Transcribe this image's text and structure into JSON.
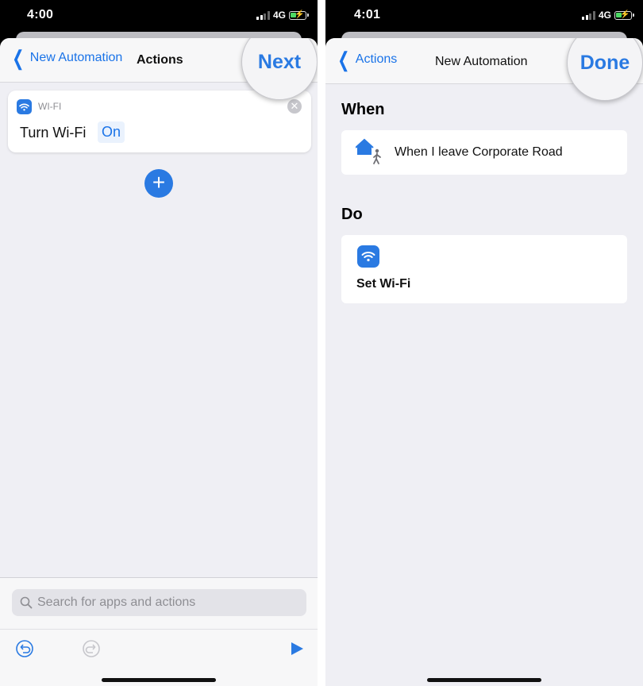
{
  "left": {
    "status": {
      "time": "4:00",
      "network": "4G"
    },
    "nav": {
      "back_label": "New Automation",
      "title": "Actions",
      "next_label": "Next"
    },
    "action_card": {
      "category": "WI-FI",
      "action": "Turn Wi-Fi",
      "param": "On"
    },
    "add_button_label": "+",
    "search": {
      "placeholder": "Search for apps and actions"
    },
    "toolbar": {
      "undo_icon": "undo-icon",
      "redo_icon": "redo-icon",
      "run_icon": "play-icon"
    }
  },
  "right": {
    "status": {
      "time": "4:01",
      "network": "4G"
    },
    "nav": {
      "back_label": "Actions",
      "title": "New Automation",
      "done_label": "Done"
    },
    "when": {
      "heading": "When",
      "trigger": "When I leave Corporate Road",
      "icon": "home-leave-icon"
    },
    "do": {
      "heading": "Do",
      "action": "Set Wi-Fi",
      "icon": "wifi-icon"
    }
  },
  "colors": {
    "accent": "#2a7ae2",
    "link": "#1a73e8",
    "sheet_bg": "#efeff4",
    "battery": "#4cd964"
  }
}
